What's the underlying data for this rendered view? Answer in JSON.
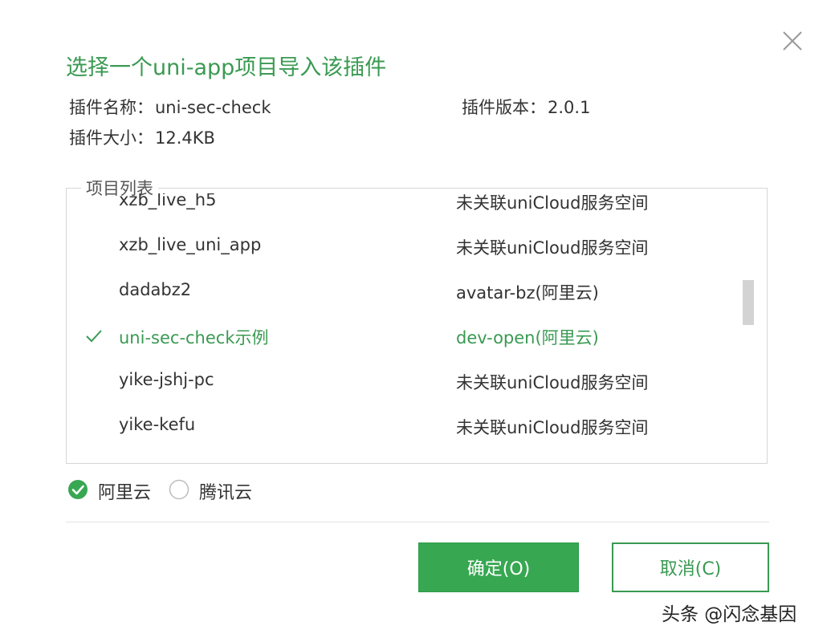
{
  "dialog": {
    "title": "选择一个uni-app项目导入该插件",
    "close_icon": "close-icon"
  },
  "plugin": {
    "name_label": "插件名称：",
    "name_value": "uni-sec-check",
    "version_label": "插件版本：",
    "version_value": "2.0.1",
    "size_label": "插件大小：",
    "size_value": "12.4KB"
  },
  "project_list": {
    "legend": "项目列表",
    "rows": [
      {
        "name": "xzb_live_h5",
        "space": "未关联uniCloud服务空间",
        "selected": false
      },
      {
        "name": "xzb_live_uni_app",
        "space": "未关联uniCloud服务空间",
        "selected": false
      },
      {
        "name": "dadabz2",
        "space": "avatar-bz(阿里云)",
        "selected": false
      },
      {
        "name": "uni-sec-check示例",
        "space": "dev-open(阿里云)",
        "selected": true
      },
      {
        "name": "yike-jshj-pc",
        "space": "未关联uniCloud服务空间",
        "selected": false
      },
      {
        "name": "yike-kefu",
        "space": "未关联uniCloud服务空间",
        "selected": false
      }
    ]
  },
  "providers": {
    "aliyun_label": "阿里云",
    "aliyun_selected": true,
    "tencent_label": "腾讯云",
    "tencent_selected": false
  },
  "buttons": {
    "ok_label": "确定(O)",
    "cancel_label": "取消(C)"
  },
  "watermark": "头条 @闪念基因",
  "colors": {
    "accent": "#38a752",
    "title_green": "#3a9a52"
  }
}
